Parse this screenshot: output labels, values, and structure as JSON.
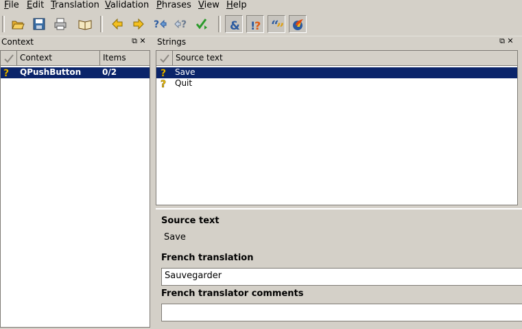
{
  "menu": [
    {
      "mnemonic": "F",
      "rest": "ile"
    },
    {
      "mnemonic": "E",
      "rest": "dit"
    },
    {
      "mnemonic": "T",
      "rest": "ranslation"
    },
    {
      "mnemonic": "V",
      "rest": "alidation"
    },
    {
      "mnemonic": "P",
      "rest": "hrases"
    },
    {
      "mnemonic": "V",
      "rest": "iew"
    },
    {
      "mnemonic": "H",
      "rest": "elp"
    }
  ],
  "toolbar": {
    "icons": [
      "open-folder-icon",
      "save-disk-icon",
      "print-icon",
      "phrase-book-icon",
      "previous-arrow-icon",
      "next-arrow-icon",
      "next-unfinished-icon",
      "previous-unfinished-icon",
      "done-and-next-icon",
      "accelerator-check-icon",
      "punctuation-check-icon",
      "phrase-match-icon",
      "placeholder-check-icon"
    ]
  },
  "context_panel": {
    "title": "Context",
    "columns": [
      "Context",
      "Items"
    ],
    "rows": [
      {
        "name": "QPushButton",
        "items": "0/2",
        "selected": true
      }
    ]
  },
  "strings_panel": {
    "title": "Strings",
    "columns": [
      "Source text"
    ],
    "rows": [
      {
        "text": "Save",
        "selected": true
      },
      {
        "text": "Quit",
        "selected": false
      }
    ]
  },
  "editor": {
    "source_label": "Source text",
    "source_value": "Save",
    "translation_label": "French translation",
    "translation_value": "Sauvegarder",
    "comments_label": "French translator comments",
    "comments_value": ""
  },
  "dock_buttons": {
    "float": "⧉",
    "close": "✕"
  },
  "colors": {
    "selection": "#0a246a",
    "window": "#d4d0c8",
    "qmark": "#f0c000"
  }
}
